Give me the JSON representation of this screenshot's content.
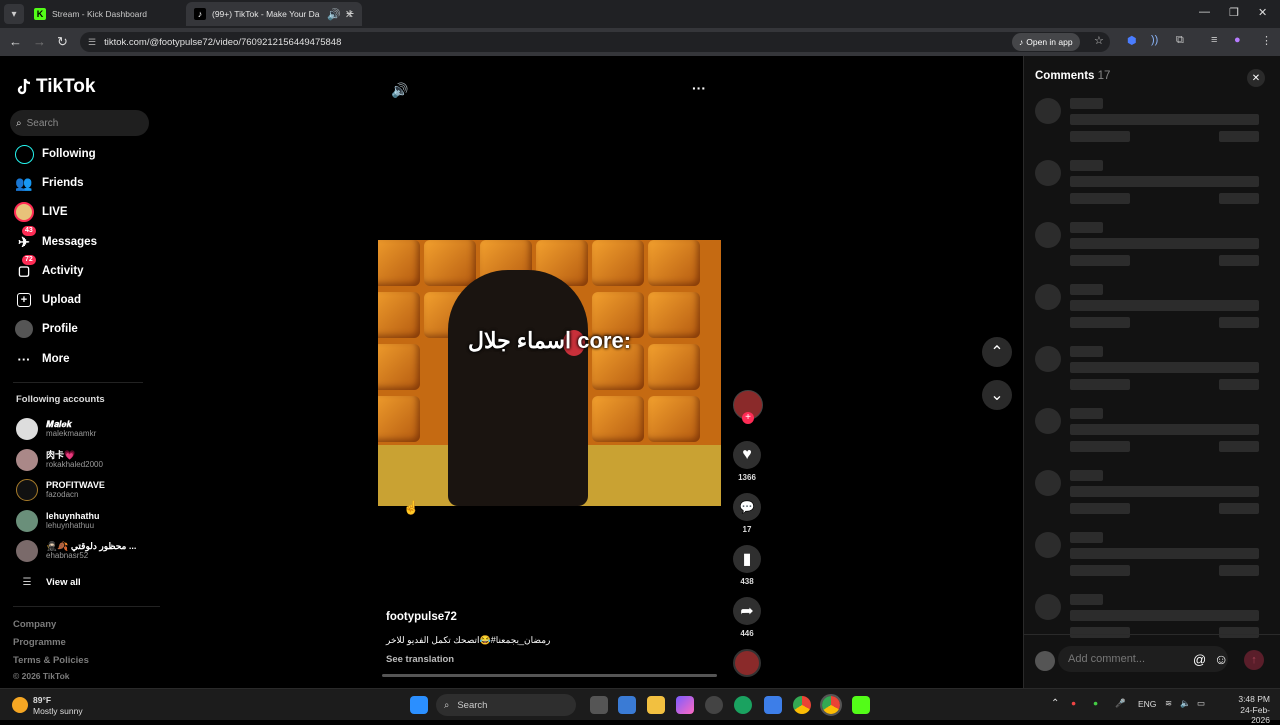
{
  "browser": {
    "tabs": [
      {
        "title": "Stream - Kick Dashboard",
        "favicon": "K"
      },
      {
        "title": "(99+) TikTok - Make Your Da",
        "favicon": "♪"
      }
    ],
    "url": "tiktok.com/@footypulse72/video/7609212156449475848",
    "open_in_app": "Open in app"
  },
  "sidebar": {
    "logo": "TikTok",
    "search_placeholder": "Search",
    "nav": [
      {
        "label": "Following",
        "icon": "following-icon"
      },
      {
        "label": "Friends",
        "icon": "friends-icon"
      },
      {
        "label": "LIVE",
        "icon": "live-icon"
      },
      {
        "label": "Messages",
        "icon": "messages-icon",
        "badge": "43"
      },
      {
        "label": "Activity",
        "icon": "activity-icon",
        "badge": "72"
      },
      {
        "label": "Upload",
        "icon": "upload-icon"
      },
      {
        "label": "Profile",
        "icon": "profile-icon"
      },
      {
        "label": "More",
        "icon": "more-icon"
      }
    ],
    "following_title": "Following accounts",
    "accounts": [
      {
        "name": "𝑴𝒂𝒍𝒆𝒌",
        "username": "malekmaamkr"
      },
      {
        "name": "肉卡💗",
        "username": "rokakhaled2000"
      },
      {
        "name": "PROFITWAVE",
        "username": "fazodacn"
      },
      {
        "name": "lehuynhathu",
        "username": "lehuynhathuu"
      },
      {
        "name": "🥷🏻🍂 محظور دلوقتي ...",
        "username": "ehabnasr52"
      }
    ],
    "view_all": "View all",
    "footer": [
      "Company",
      "Programme",
      "Terms & Policies"
    ],
    "copyright": "© 2026 TikTok"
  },
  "video": {
    "overlay_text": "اسماء جلال core:",
    "author": "footypulse72",
    "description": "رمضان_يجمعنا#😂اتصحك تكمل الفديو للاخر",
    "see_translation": "See translation"
  },
  "actions": {
    "likes": "1366",
    "comments": "17",
    "saves": "438",
    "shares": "446"
  },
  "comments_panel": {
    "title": "Comments",
    "count": "17",
    "placeholder": "Add comment..."
  },
  "taskbar": {
    "weather_temp": "89°F",
    "weather_desc": "Mostly sunny",
    "search": "Search",
    "lang": "ENG",
    "time": "3:48 PM",
    "date": "24-Feb-2026"
  },
  "colors": {
    "accent": "#fe2c55",
    "background": "#000000"
  }
}
